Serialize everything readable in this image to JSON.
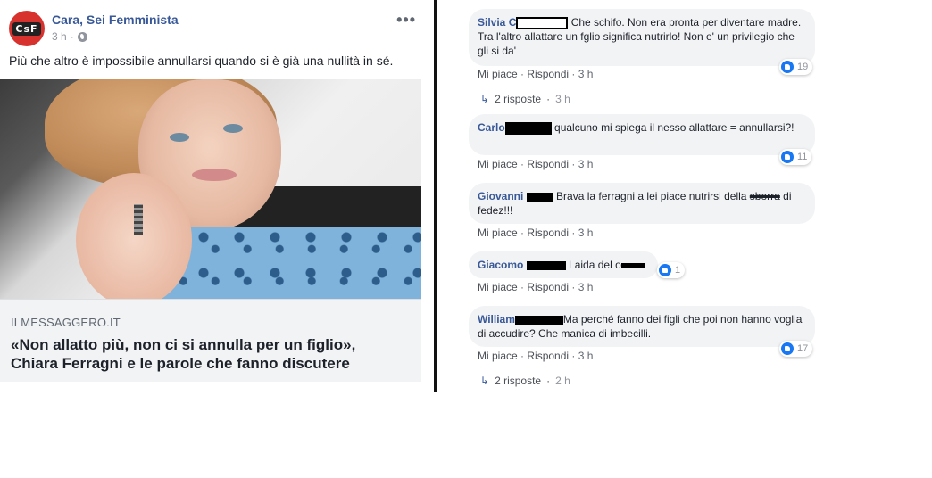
{
  "post": {
    "page_name": "Cara, Sei Femminista",
    "avatar_text": "CsF",
    "time": "3 h",
    "dot": "·",
    "more": "•••",
    "text": "Più che altro è impossibile annullarsi quando si è già una nullità in sé.",
    "link_domain": "ILMESSAGGERO.IT",
    "link_title": "«Non allatto più, non ci si annulla per un figlio», Chiara Ferragni e le parole che fanno discutere"
  },
  "comments": [
    {
      "name": "Silvia",
      "name_suffix": " C",
      "text": " Che schifo. Non era pronta per diventare madre. Tra l'altro allattare un fglio significa nutrirlo! Non e' un privilegio che gli si da'",
      "like": "Mi piace",
      "reply": "Rispondi",
      "time": "3 h",
      "reactions": "19",
      "replies_label": "2 risposte",
      "replies_time": "3 h"
    },
    {
      "name": "Carlo",
      "text": " qualcuno mi spiega il nesso allattare = annullarsi?!",
      "like": "Mi piace",
      "reply": "Rispondi",
      "time": "3 h",
      "reactions": "11"
    },
    {
      "name": "Giovanni",
      "text": " Brava la ferragni a lei piace nutrirsi della ",
      "text_struck": "sborra",
      "text_end": " di fedez!!!",
      "like": "Mi piace",
      "reply": "Rispondi",
      "time": "3 h"
    },
    {
      "name": "Giacomo",
      "text": " Laida del ",
      "text_end": "o",
      "like": "Mi piace",
      "reply": "Rispondi",
      "time": "3 h",
      "reactions": "1"
    },
    {
      "name": "William",
      "text": "Ma perché fanno dei figli che poi non hanno voglia di accudire? Che manica di imbecilli.",
      "like": "Mi piace",
      "reply": "Rispondi",
      "time": "3 h",
      "reactions": "17",
      "replies_label": "2 risposte",
      "replies_time": "2 h"
    }
  ],
  "sep": "·"
}
